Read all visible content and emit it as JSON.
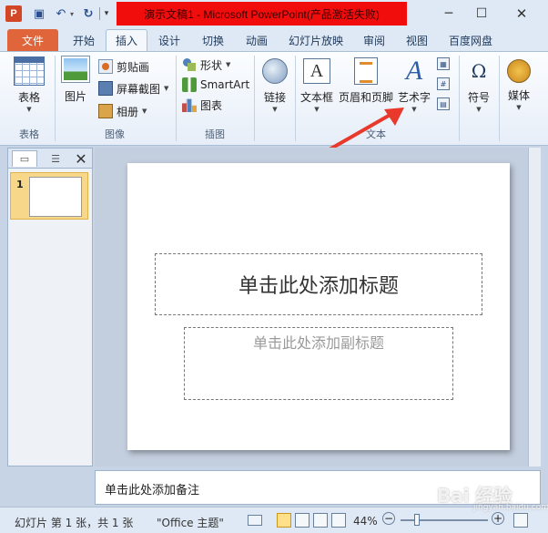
{
  "titlebar": {
    "app_icon": "P",
    "title": "演示文稿1 - Microsoft PowerPoint(产品激活失败)",
    "min": "─",
    "max": "☐",
    "close": "✕"
  },
  "tabs": {
    "file": "文件",
    "home": "开始",
    "insert": "插入",
    "design": "设计",
    "transitions": "切换",
    "animations": "动画",
    "slideshow": "幻灯片放映",
    "review": "审阅",
    "view": "视图",
    "netdisk": "百度网盘",
    "help": "?"
  },
  "ribbon": {
    "groups": {
      "table": "表格",
      "images": "图像",
      "illustrations": "插图",
      "text": "文本"
    },
    "table_btn": "表格",
    "picture_btn": "图片",
    "clipart_btn": "剪贴画",
    "screenshot_btn": "屏幕截图",
    "album_btn": "相册",
    "shapes_btn": "形状",
    "smartart_btn": "SmartArt",
    "chart_btn": "图表",
    "link_btn": "链接",
    "textbox_btn": "文本框",
    "header_btn": "页眉和页脚",
    "wordart_btn": "艺术字",
    "symbol_btn": "符号",
    "media_btn": "媒体",
    "textbox_glyph": "A",
    "wordart_glyph": "A",
    "symbol_glyph": "Ω"
  },
  "slide": {
    "number": "1",
    "title_placeholder": "单击此处添加标题",
    "subtitle_placeholder": "单击此处添加副标题"
  },
  "notes": {
    "placeholder": "单击此处添加备注"
  },
  "status": {
    "slide_info": "幻灯片 第 1 张，共 1 张",
    "theme": "\"Office 主题\"",
    "zoom": "44%",
    "zoom_level": 0.44
  },
  "watermark": "Bai 经验",
  "watermark_sub": "jingyan.baidu.com",
  "colors": {
    "title_highlight": "#f20d0d",
    "file_tab": "#e0653b",
    "annotation_arrow": "#e8392c"
  }
}
